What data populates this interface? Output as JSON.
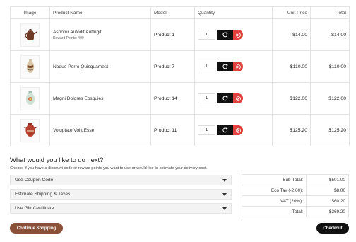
{
  "colors": {
    "accent_brown": "#8a5038",
    "remove_red": "#e0413e",
    "dark": "#111111",
    "border": "#e3e3e3"
  },
  "cart": {
    "headers": {
      "image": "Image",
      "name": "Product Name",
      "model": "Model",
      "quantity": "Quantity",
      "unit_price": "Unit Price",
      "total": "Total"
    },
    "rows": [
      {
        "image_icon": "teapot-thumbnail",
        "name": "Aspotur Autodit Autfugit",
        "reward": "Reward Points: 400",
        "model": "Product 1",
        "qty": "1",
        "unit_price": "$14.00",
        "total": "$14.00"
      },
      {
        "image_icon": "vase-thumbnail",
        "name": "Noque Porro Quisquamest",
        "reward": "",
        "model": "Product 7",
        "qty": "1",
        "unit_price": "$110.00",
        "total": "$110.00"
      },
      {
        "image_icon": "jar-thumbnail",
        "name": "Magni Dolores Eosquies",
        "reward": "",
        "model": "Product 14",
        "qty": "1",
        "unit_price": "$122.00",
        "total": "$122.00"
      },
      {
        "image_icon": "urn-thumbnail",
        "name": "Voluptate Volit Esse",
        "reward": "",
        "model": "Product 11",
        "qty": "1",
        "unit_price": "$125.20",
        "total": "$125.20"
      }
    ],
    "update_icon": "refresh-icon",
    "remove_icon": "close-circle-icon"
  },
  "next": {
    "heading": "What would you like to do next?",
    "description": "Choose if you have a discount code or reward points you want to use or would like to estimate your delivery cost.",
    "options": [
      {
        "label": "Use Coupon Code"
      },
      {
        "label": "Estimate Shipping & Taxes"
      },
      {
        "label": "Use Gift Certificate"
      }
    ],
    "chevron_icon": "caret-down-icon"
  },
  "totals": [
    {
      "label": "Sub-Total:",
      "value": "$501.00"
    },
    {
      "label": "Eco Tax (-2.00):",
      "value": "$8.00"
    },
    {
      "label": "VAT (20%):",
      "value": "$60.20"
    },
    {
      "label": "Total:",
      "value": "$369.20"
    }
  ],
  "actions": {
    "continue_label": "Continue Shopping",
    "checkout_label": "Checkout"
  }
}
